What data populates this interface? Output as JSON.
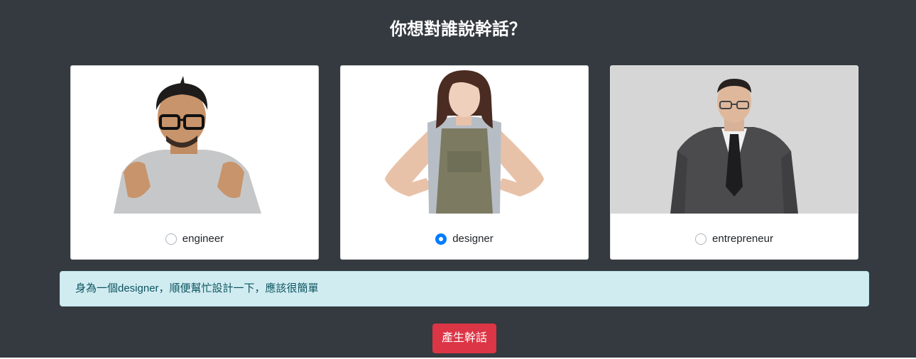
{
  "page": {
    "title": "你想對誰說幹話？"
  },
  "options": [
    {
      "label": "engineer",
      "value": "engineer",
      "checked": false
    },
    {
      "label": "designer",
      "value": "designer",
      "checked": true
    },
    {
      "label": "entrepreneur",
      "value": "entrepreneur",
      "checked": false
    }
  ],
  "result": {
    "text": "身為一個designer，順便幫忙設計一下，應該很簡單"
  },
  "generate_button": {
    "label": "產生幹話"
  },
  "colors": {
    "background": "#343a40",
    "accent": "#007bff",
    "alert_bg": "#d1ecf1",
    "alert_text": "#0c5460",
    "button": "#dc3545"
  }
}
